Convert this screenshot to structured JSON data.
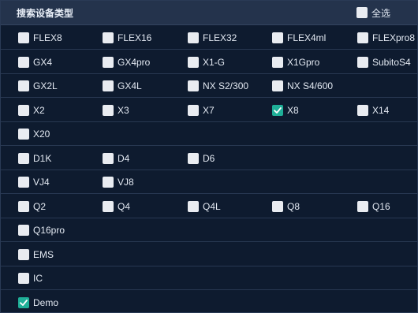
{
  "header": {
    "title": "搜索设备类型",
    "select_all_label": "全选",
    "select_all_checked": false
  },
  "rows": [
    {
      "items": [
        {
          "label": "FLEX8",
          "checked": false
        },
        {
          "label": "FLEX16",
          "checked": false
        },
        {
          "label": "FLEX32",
          "checked": false
        },
        {
          "label": "FLEX4ml",
          "checked": false
        },
        {
          "label": "FLEXpro8",
          "checked": false
        }
      ]
    },
    {
      "items": [
        {
          "label": "GX4",
          "checked": false
        },
        {
          "label": "GX4pro",
          "checked": false
        },
        {
          "label": "X1-G",
          "checked": false
        },
        {
          "label": "X1Gpro",
          "checked": false
        },
        {
          "label": "SubitoS4",
          "checked": false
        }
      ]
    },
    {
      "items": [
        {
          "label": "GX2L",
          "checked": false
        },
        {
          "label": "GX4L",
          "checked": false
        },
        {
          "label": "NX S2/300",
          "checked": false
        },
        {
          "label": "NX S4/600",
          "checked": false
        }
      ]
    },
    {
      "items": [
        {
          "label": "X2",
          "checked": false
        },
        {
          "label": "X3",
          "checked": false
        },
        {
          "label": "X7",
          "checked": false
        },
        {
          "label": "X8",
          "checked": true
        },
        {
          "label": "X14",
          "checked": false
        }
      ]
    },
    {
      "items": [
        {
          "label": "X20",
          "checked": false
        }
      ]
    },
    {
      "items": [
        {
          "label": "D1K",
          "checked": false
        },
        {
          "label": "D4",
          "checked": false
        },
        {
          "label": "D6",
          "checked": false
        }
      ]
    },
    {
      "items": [
        {
          "label": "VJ4",
          "checked": false
        },
        {
          "label": "VJ8",
          "checked": false
        }
      ]
    },
    {
      "items": [
        {
          "label": "Q2",
          "checked": false
        },
        {
          "label": "Q4",
          "checked": false
        },
        {
          "label": "Q4L",
          "checked": false
        },
        {
          "label": "Q8",
          "checked": false
        },
        {
          "label": "Q16",
          "checked": false
        }
      ]
    },
    {
      "items": [
        {
          "label": "Q16pro",
          "checked": false
        }
      ]
    },
    {
      "items": [
        {
          "label": "EMS",
          "checked": false
        }
      ]
    },
    {
      "items": [
        {
          "label": "IC",
          "checked": false
        }
      ]
    },
    {
      "items": [
        {
          "label": "Demo",
          "checked": true
        }
      ]
    }
  ]
}
